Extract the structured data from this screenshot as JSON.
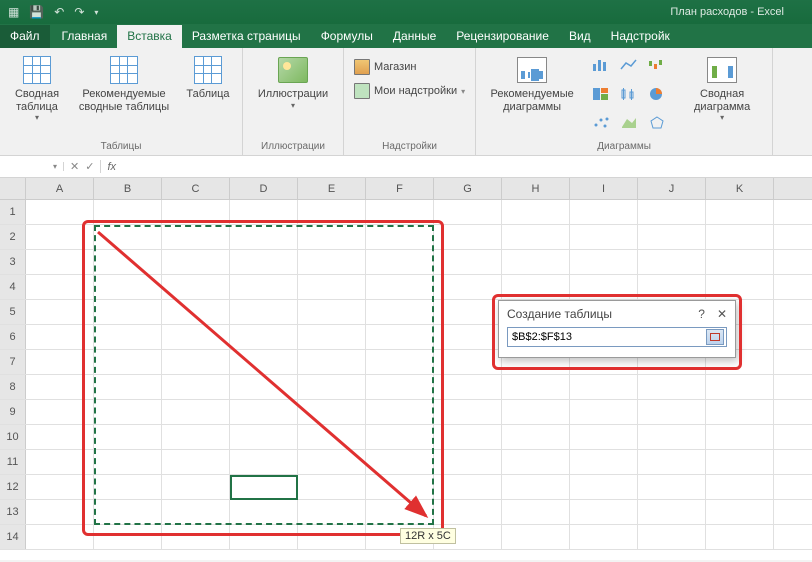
{
  "titlebar": {
    "title": "План расходов - Excel"
  },
  "tabs": {
    "file": "Файл",
    "items": [
      "Главная",
      "Вставка",
      "Разметка страницы",
      "Формулы",
      "Данные",
      "Рецензирование",
      "Вид",
      "Надстройк"
    ],
    "active_index": 1
  },
  "ribbon": {
    "tables": {
      "pivot": "Сводная\nтаблица",
      "recpivot": "Рекомендуемые\nсводные таблицы",
      "table": "Таблица",
      "group": "Таблицы"
    },
    "illus": {
      "btn": "Иллюстрации",
      "group": "Иллюстрации"
    },
    "addins": {
      "store": "Магазин",
      "myaddins": "Мои надстройки",
      "group": "Надстройки"
    },
    "charts": {
      "rec": "Рекомендуемые\nдиаграммы",
      "pivot": "Сводная\nдиаграмма",
      "group": "Диаграммы"
    }
  },
  "formula_bar": {
    "name_box": "",
    "fx": "fx"
  },
  "columns": [
    "A",
    "B",
    "C",
    "D",
    "E",
    "F",
    "G",
    "H",
    "I",
    "J",
    "K"
  ],
  "rows": [
    "1",
    "2",
    "3",
    "4",
    "5",
    "6",
    "7",
    "8",
    "9",
    "10",
    "11",
    "12",
    "13",
    "14"
  ],
  "dim_tip": "12R x 5C",
  "dialog": {
    "title": "Создание таблицы",
    "help": "?",
    "close": "✕",
    "range": "$B$2:$F$13"
  }
}
